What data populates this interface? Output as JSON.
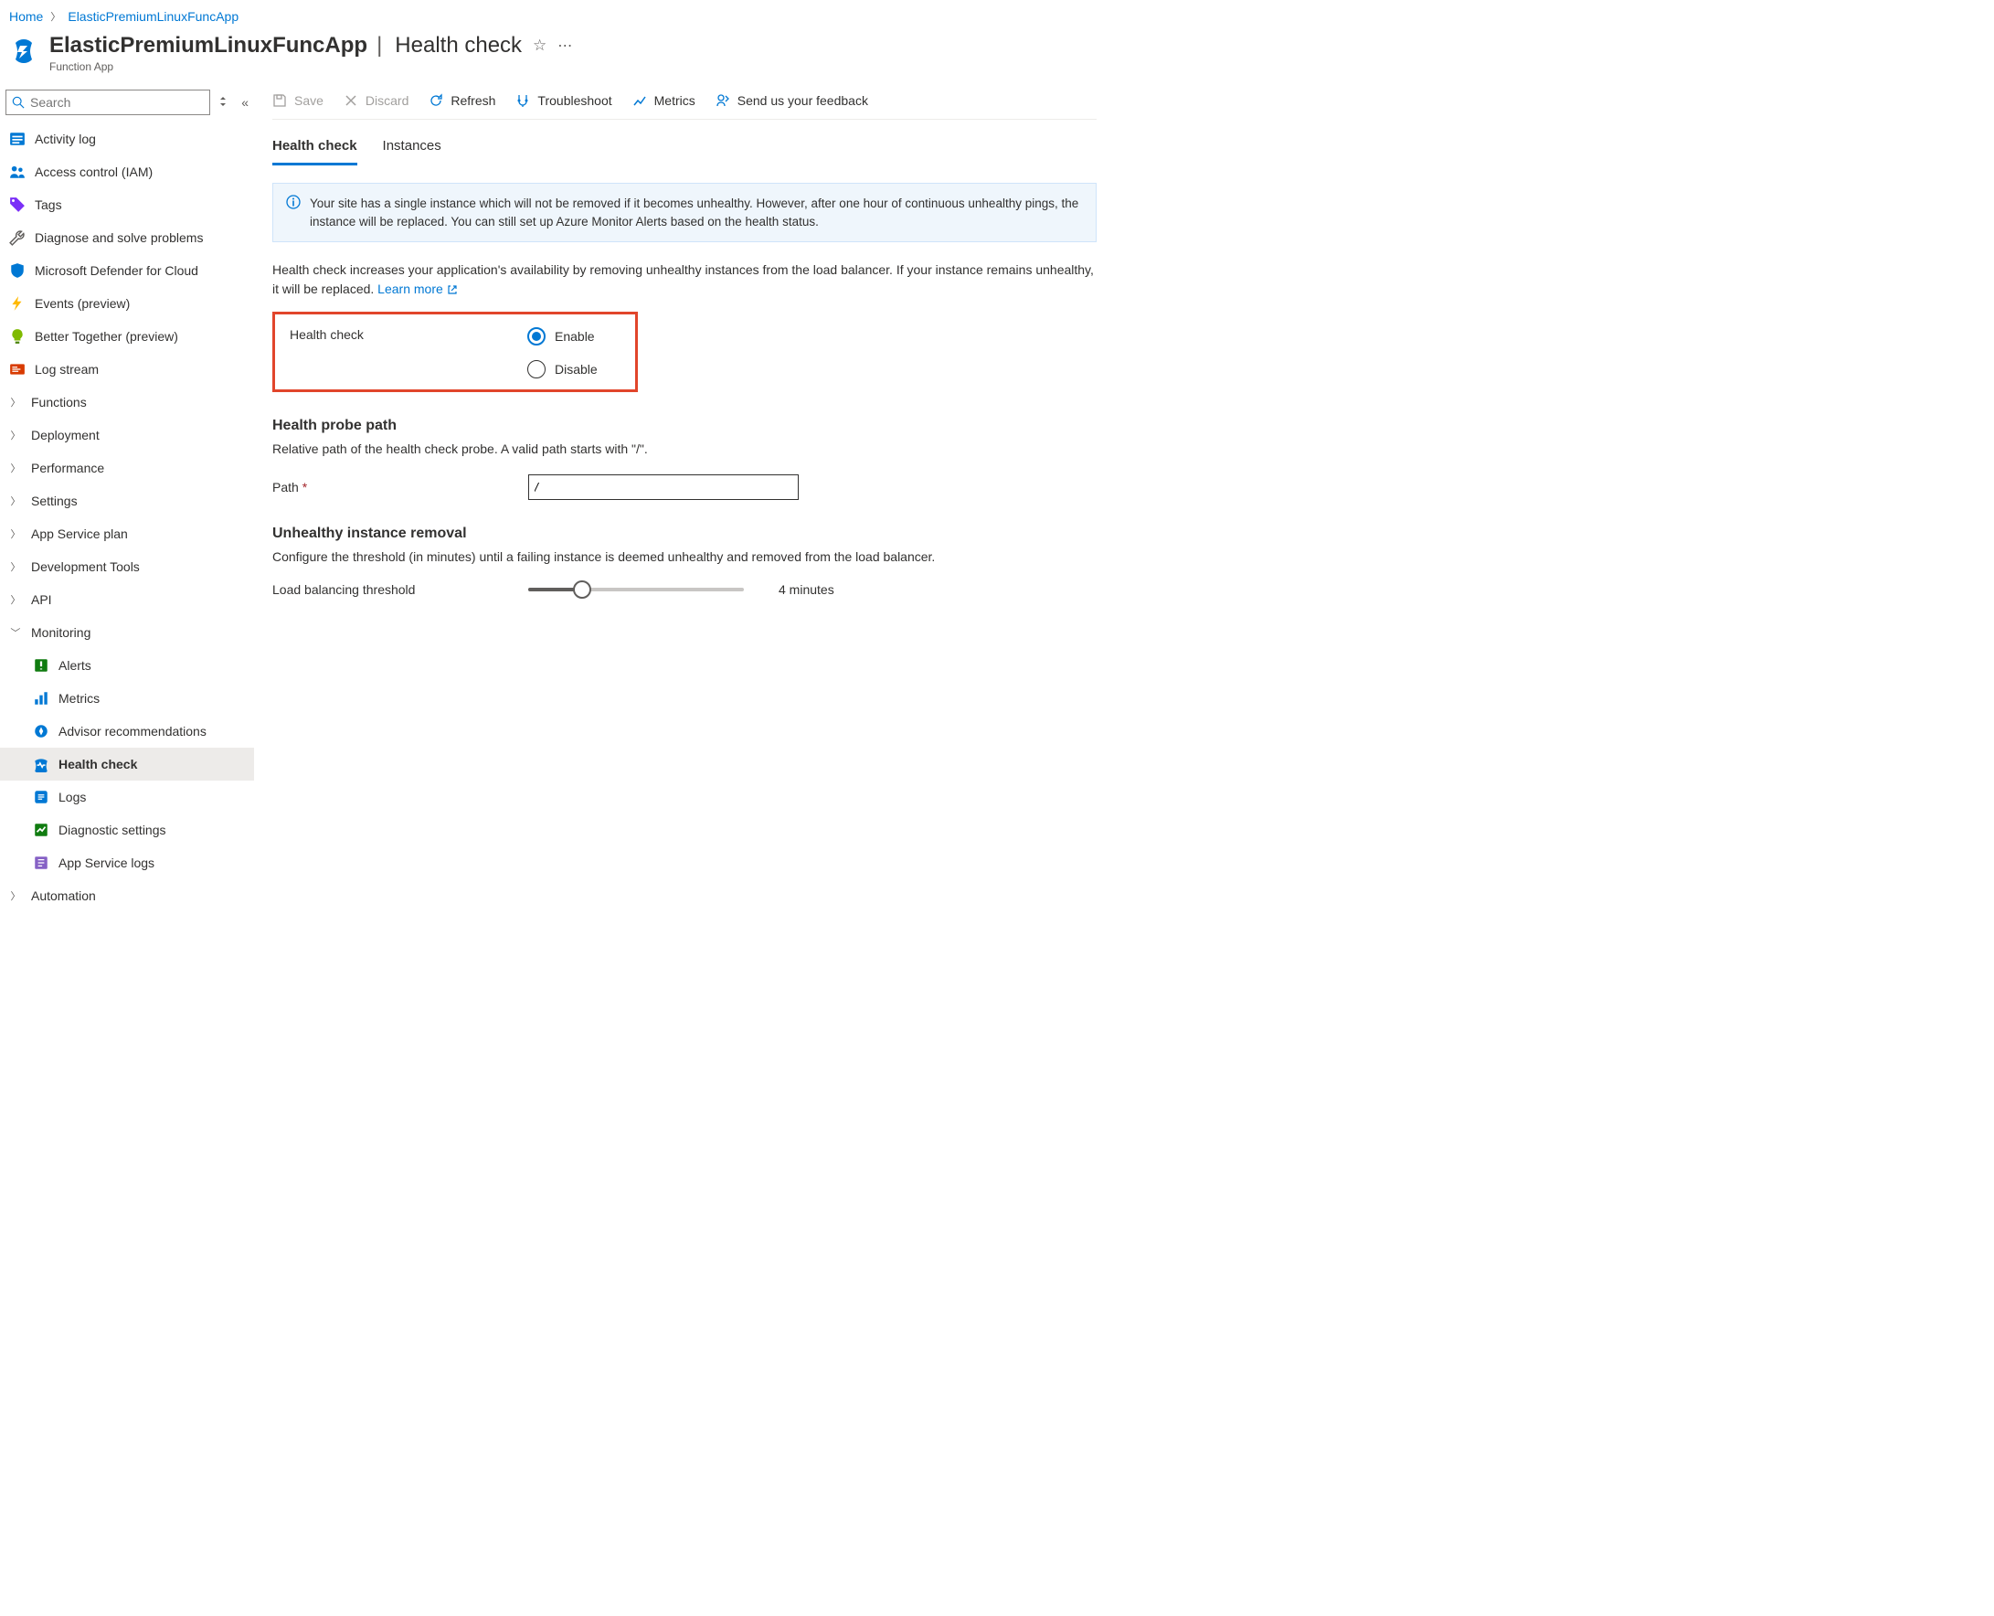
{
  "breadcrumb": {
    "home": "Home",
    "current": "ElasticPremiumLinuxFuncApp"
  },
  "header": {
    "title": "ElasticPremiumLinuxFuncApp",
    "subtitle": "Health check",
    "subtype": "Function App"
  },
  "sidebar": {
    "search_placeholder": "Search",
    "items": [
      {
        "label": "Activity log"
      },
      {
        "label": "Access control (IAM)"
      },
      {
        "label": "Tags"
      },
      {
        "label": "Diagnose and solve problems"
      },
      {
        "label": "Microsoft Defender for Cloud"
      },
      {
        "label": "Events (preview)"
      },
      {
        "label": "Better Together (preview)"
      },
      {
        "label": "Log stream"
      }
    ],
    "collapsible": [
      {
        "label": "Functions"
      },
      {
        "label": "Deployment"
      },
      {
        "label": "Performance"
      },
      {
        "label": "Settings"
      },
      {
        "label": "App Service plan"
      },
      {
        "label": "Development Tools"
      },
      {
        "label": "API"
      }
    ],
    "monitoring": {
      "label": "Monitoring",
      "children": [
        {
          "label": "Alerts"
        },
        {
          "label": "Metrics"
        },
        {
          "label": "Advisor recommendations"
        },
        {
          "label": "Health check"
        },
        {
          "label": "Logs"
        },
        {
          "label": "Diagnostic settings"
        },
        {
          "label": "App Service logs"
        }
      ]
    },
    "automation": {
      "label": "Automation"
    }
  },
  "toolbar": {
    "save": "Save",
    "discard": "Discard",
    "refresh": "Refresh",
    "troubleshoot": "Troubleshoot",
    "metrics": "Metrics",
    "feedback": "Send us your feedback"
  },
  "tabs": {
    "health": "Health check",
    "instances": "Instances"
  },
  "info_text": "Your site has a single instance which will not be removed if it becomes unhealthy. However, after one hour of continuous unhealthy pings, the instance will be replaced. You can still set up Azure Monitor Alerts based on the health status.",
  "desc_text": "Health check increases your application's availability by removing unhealthy instances from the load balancer. If your instance remains unhealthy, it will be replaced. ",
  "learn_more": "Learn more",
  "radio": {
    "label": "Health check",
    "enable": "Enable",
    "disable": "Disable"
  },
  "probe": {
    "heading": "Health probe path",
    "desc": "Relative path of the health check probe. A valid path starts with \"/\".",
    "label": "Path",
    "value": "/"
  },
  "removal": {
    "heading": "Unhealthy instance removal",
    "desc": "Configure the threshold (in minutes) until a failing instance is deemed unhealthy and removed from the load balancer.",
    "label": "Load balancing threshold",
    "value": "4 minutes"
  }
}
